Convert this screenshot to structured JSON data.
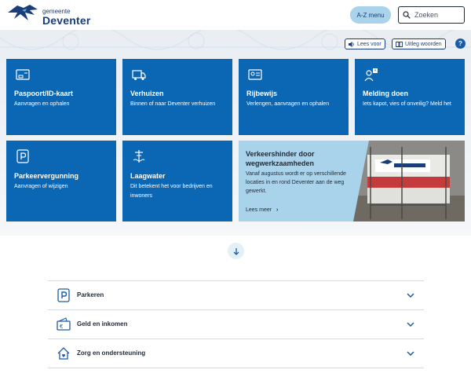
{
  "header": {
    "logo_small": "gemeente",
    "logo_big": "Deventer",
    "az_menu_label": "A-Z menu",
    "search_placeholder": "Zoeken",
    "brand_color": "#1a3e7a"
  },
  "toolbar": {
    "read_aloud_label": "Lees voor",
    "explain_words_label": "Uitleg woorden",
    "help_label": "?"
  },
  "tiles": [
    {
      "title": "Paspoort/ID-kaart",
      "description": "Aanvragen en ophalen",
      "icon": "id-card-icon"
    },
    {
      "title": "Verhuizen",
      "description": "Binnen of naar Deventer verhuizen",
      "icon": "moving-truck-icon"
    },
    {
      "title": "Rijbewijs",
      "description": "Verlengen, aanvragen en ophalen",
      "icon": "drivers-license-icon"
    },
    {
      "title": "Melding doen",
      "description": "Iets kapot, vies of onveilig? Meld het",
      "icon": "report-person-icon"
    },
    {
      "title": "Parkeervergunning",
      "description": "Aanvragen of wijzigen",
      "icon": "parking-icon"
    },
    {
      "title": "Laagwater",
      "description": "Dit betekent het voor bedrijven en inwoners",
      "icon": "water-level-icon"
    }
  ],
  "news": {
    "title": "Verkeershinder door wegwerkzaamheden",
    "description": "Vanaf augustus wordt er op verschillende locaties in en rond Deventer aan de weg gewerkt.",
    "more_label": "Lees meer"
  },
  "accordion": [
    {
      "label": "Parkeren",
      "icon": "parking-icon"
    },
    {
      "label": "Geld en inkomen",
      "icon": "wallet-icon"
    },
    {
      "label": "Zorg en ondersteuning",
      "icon": "care-house-icon"
    }
  ],
  "colors": {
    "tile_blue": "#0b66b3",
    "news_bg": "#a9d3ea",
    "az_bg": "#a9d3ea"
  }
}
